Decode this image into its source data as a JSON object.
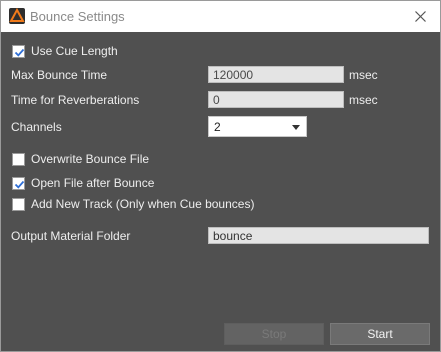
{
  "window": {
    "title": "Bounce Settings"
  },
  "options": {
    "use_cue_length": {
      "label": "Use Cue Length",
      "checked": true
    },
    "overwrite_bounce_file": {
      "label": "Overwrite Bounce File",
      "checked": false
    },
    "open_file_after_bounce": {
      "label": "Open File after Bounce",
      "checked": true
    },
    "add_new_track": {
      "label": "Add New Track  (Only when Cue bounces)",
      "checked": false
    }
  },
  "fields": {
    "max_bounce_time": {
      "label": "Max Bounce Time",
      "value": "120000",
      "unit": "msec"
    },
    "reverberations": {
      "label": "Time for Reverberations",
      "value": "0",
      "unit": "msec"
    },
    "channels": {
      "label": "Channels",
      "value": "2"
    },
    "output_folder": {
      "label": "Output Material Folder",
      "value": "bounce"
    }
  },
  "buttons": {
    "stop": "Stop",
    "start": "Start"
  },
  "colors": {
    "background": "#505050",
    "titlebar": "#ffffff",
    "field": "#e4e4e4"
  }
}
